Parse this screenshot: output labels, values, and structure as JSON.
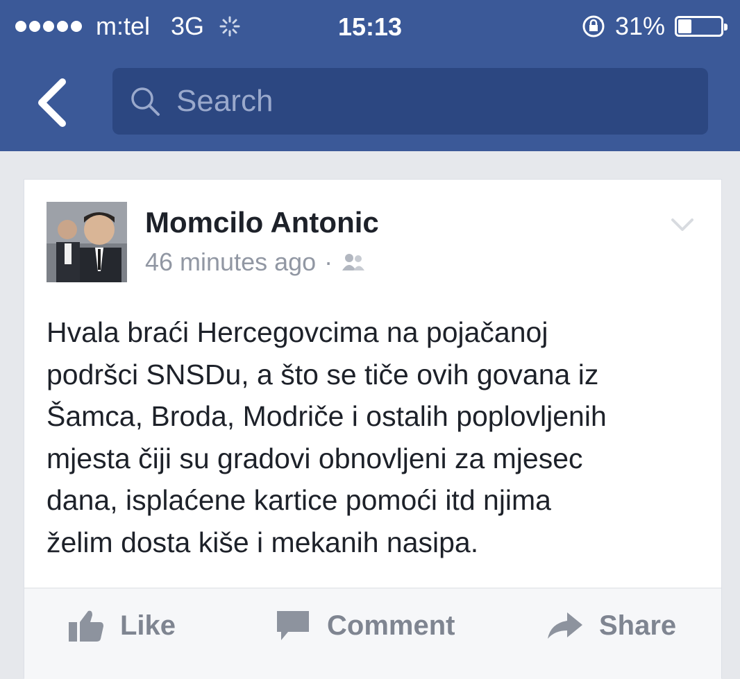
{
  "status_bar": {
    "carrier": "m:tel",
    "network": "3G",
    "time": "15:13",
    "battery": "31%",
    "battery_level": 0.31
  },
  "nav": {
    "search_placeholder": "Search"
  },
  "post": {
    "author": "Momcilo Antonic",
    "timestamp": "46 minutes ago",
    "separator": "·",
    "audience_icon": "friends-icon",
    "body_lines": [
      "Hvala braći Hercegovcima na pojačanoj",
      "podršci SNSDu, a što se tiče ovih govana iz",
      "Šamca, Broda, Modriče i ostalih poplovljenih",
      "mjesta čiji su gradovi obnovljeni za mjesec",
      "dana, isplaćene kartice pomoći itd njima",
      "želim dosta kiše i mekanih nasipa."
    ]
  },
  "actions": {
    "like": "Like",
    "comment": "Comment",
    "share": "Share"
  },
  "colors": {
    "brand": "#3b5998",
    "search_bg": "#2c4781",
    "meta_text": "#9197a3",
    "action_text": "#7f8591"
  }
}
